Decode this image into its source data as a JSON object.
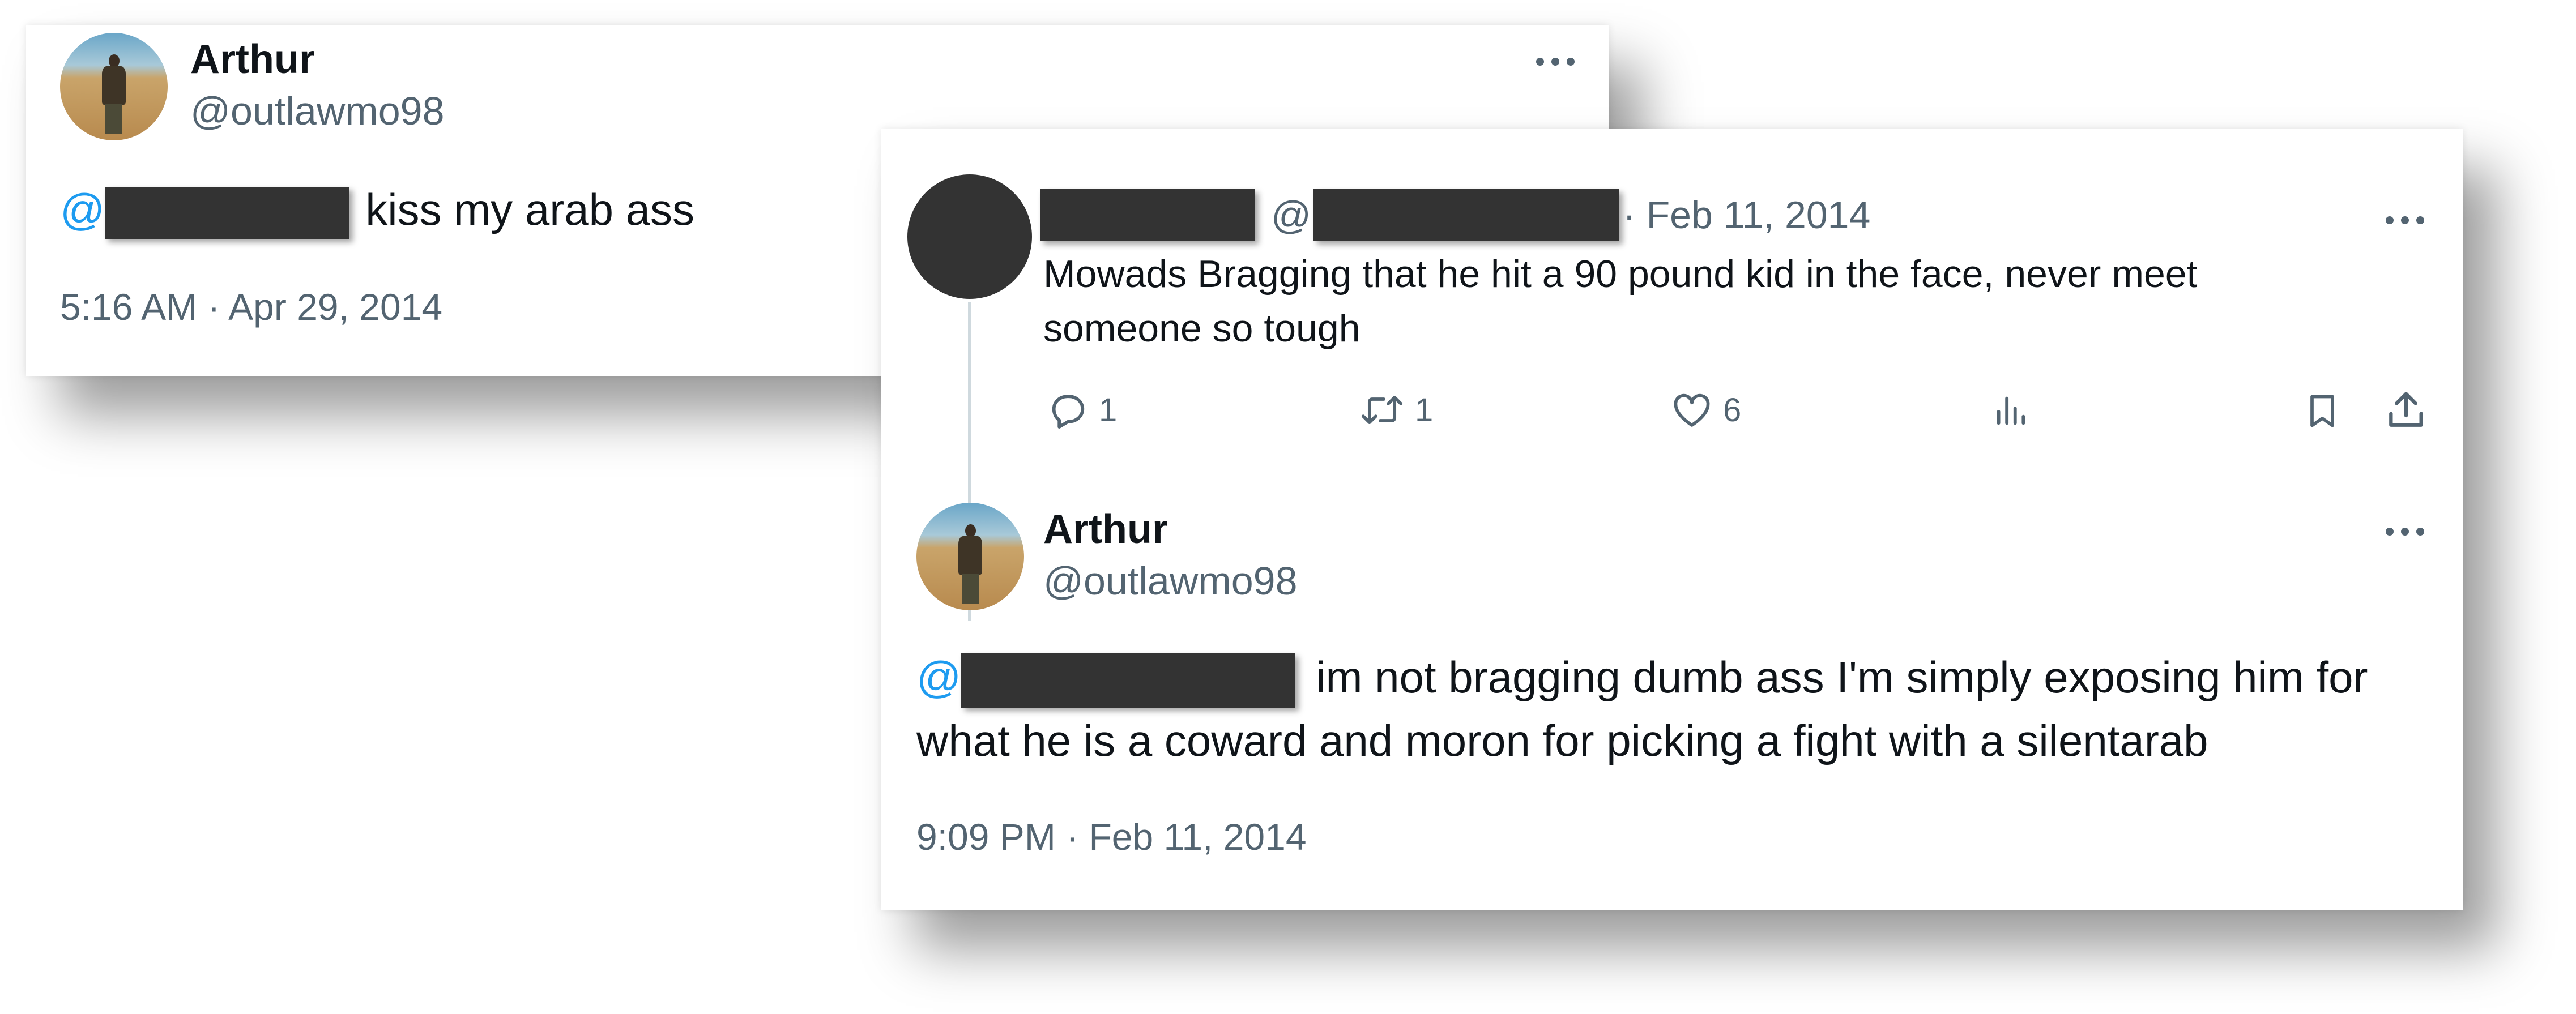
{
  "back_tweet": {
    "author": {
      "name": "Arthur",
      "handle": "@outlawmo98",
      "avatar_icon": "profile-photo"
    },
    "text": {
      "mention_at": "@",
      "body": "kiss my arab ass"
    },
    "timestamp": "5:16 AM · Apr 29, 2014",
    "more_icon": "more-horizontal-icon"
  },
  "front_card": {
    "parent_tweet": {
      "handle_prefix": "@",
      "date": "· Feb 11, 2014",
      "text": "Mowads Bragging that he hit a 90 pound kid in the face, never meet someone so tough",
      "actions": {
        "replies": "1",
        "retweets": "1",
        "likes": "6"
      },
      "icons": [
        "reply-icon",
        "retweet-icon",
        "like-icon",
        "views-icon",
        "bookmark-icon",
        "share-icon"
      ]
    },
    "reply_tweet": {
      "author": {
        "name": "Arthur",
        "handle": "@outlawmo98"
      },
      "text": {
        "mention_at": "@",
        "body": "im not bragging dumb ass I'm simply exposing him for what he is a coward and moron for picking a fight with a silentarab"
      },
      "timestamp": "9:09 PM · Feb 11, 2014"
    }
  },
  "colors": {
    "text_primary": "#0f1419",
    "text_secondary": "#536471",
    "mention": "#1d9bf0",
    "redaction": "#333333",
    "thread_line": "#cfd9de"
  }
}
